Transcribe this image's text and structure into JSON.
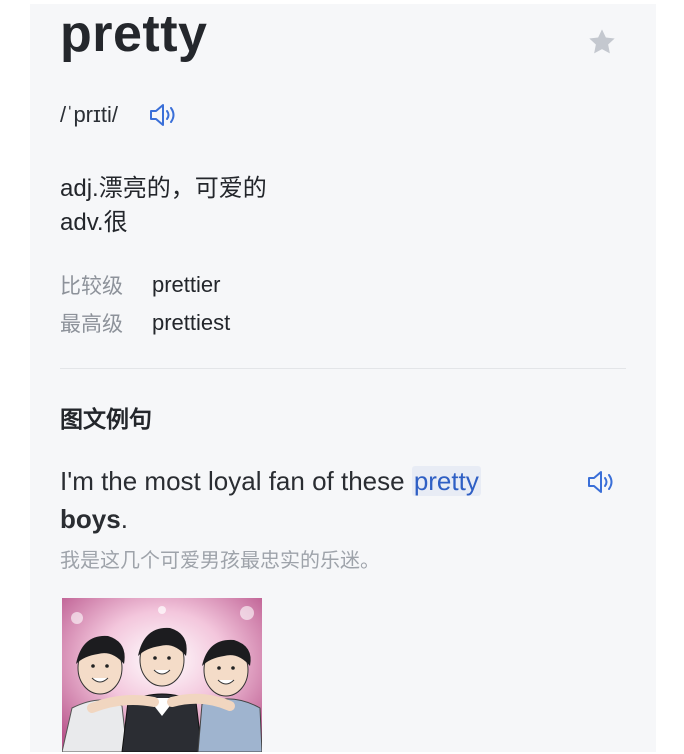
{
  "entry": {
    "word": "pretty",
    "phonetic": "/ˈprɪti/",
    "definitions": [
      "adj.漂亮的，可爱的",
      "adv.很"
    ],
    "forms": [
      {
        "label": "比较级",
        "value": "prettier"
      },
      {
        "label": "最高级",
        "value": "prettiest"
      }
    ]
  },
  "examples_section": {
    "title": "图文例句",
    "sentence_before": "I'm the most loyal fan of these ",
    "sentence_highlight": "pretty",
    "sentence_after_bold": "boys",
    "sentence_end": ".",
    "translation": "我是这几个可爱男孩最忠实的乐迷。"
  },
  "icons": {
    "favorite": "star-icon",
    "pronounce": "speaker-icon",
    "example_pronounce": "speaker-icon"
  },
  "colors": {
    "accent": "#3a6fd8",
    "star": "#c4c8cf",
    "muted_text": "#8d929a",
    "highlight_bg": "#e8ecf5"
  }
}
